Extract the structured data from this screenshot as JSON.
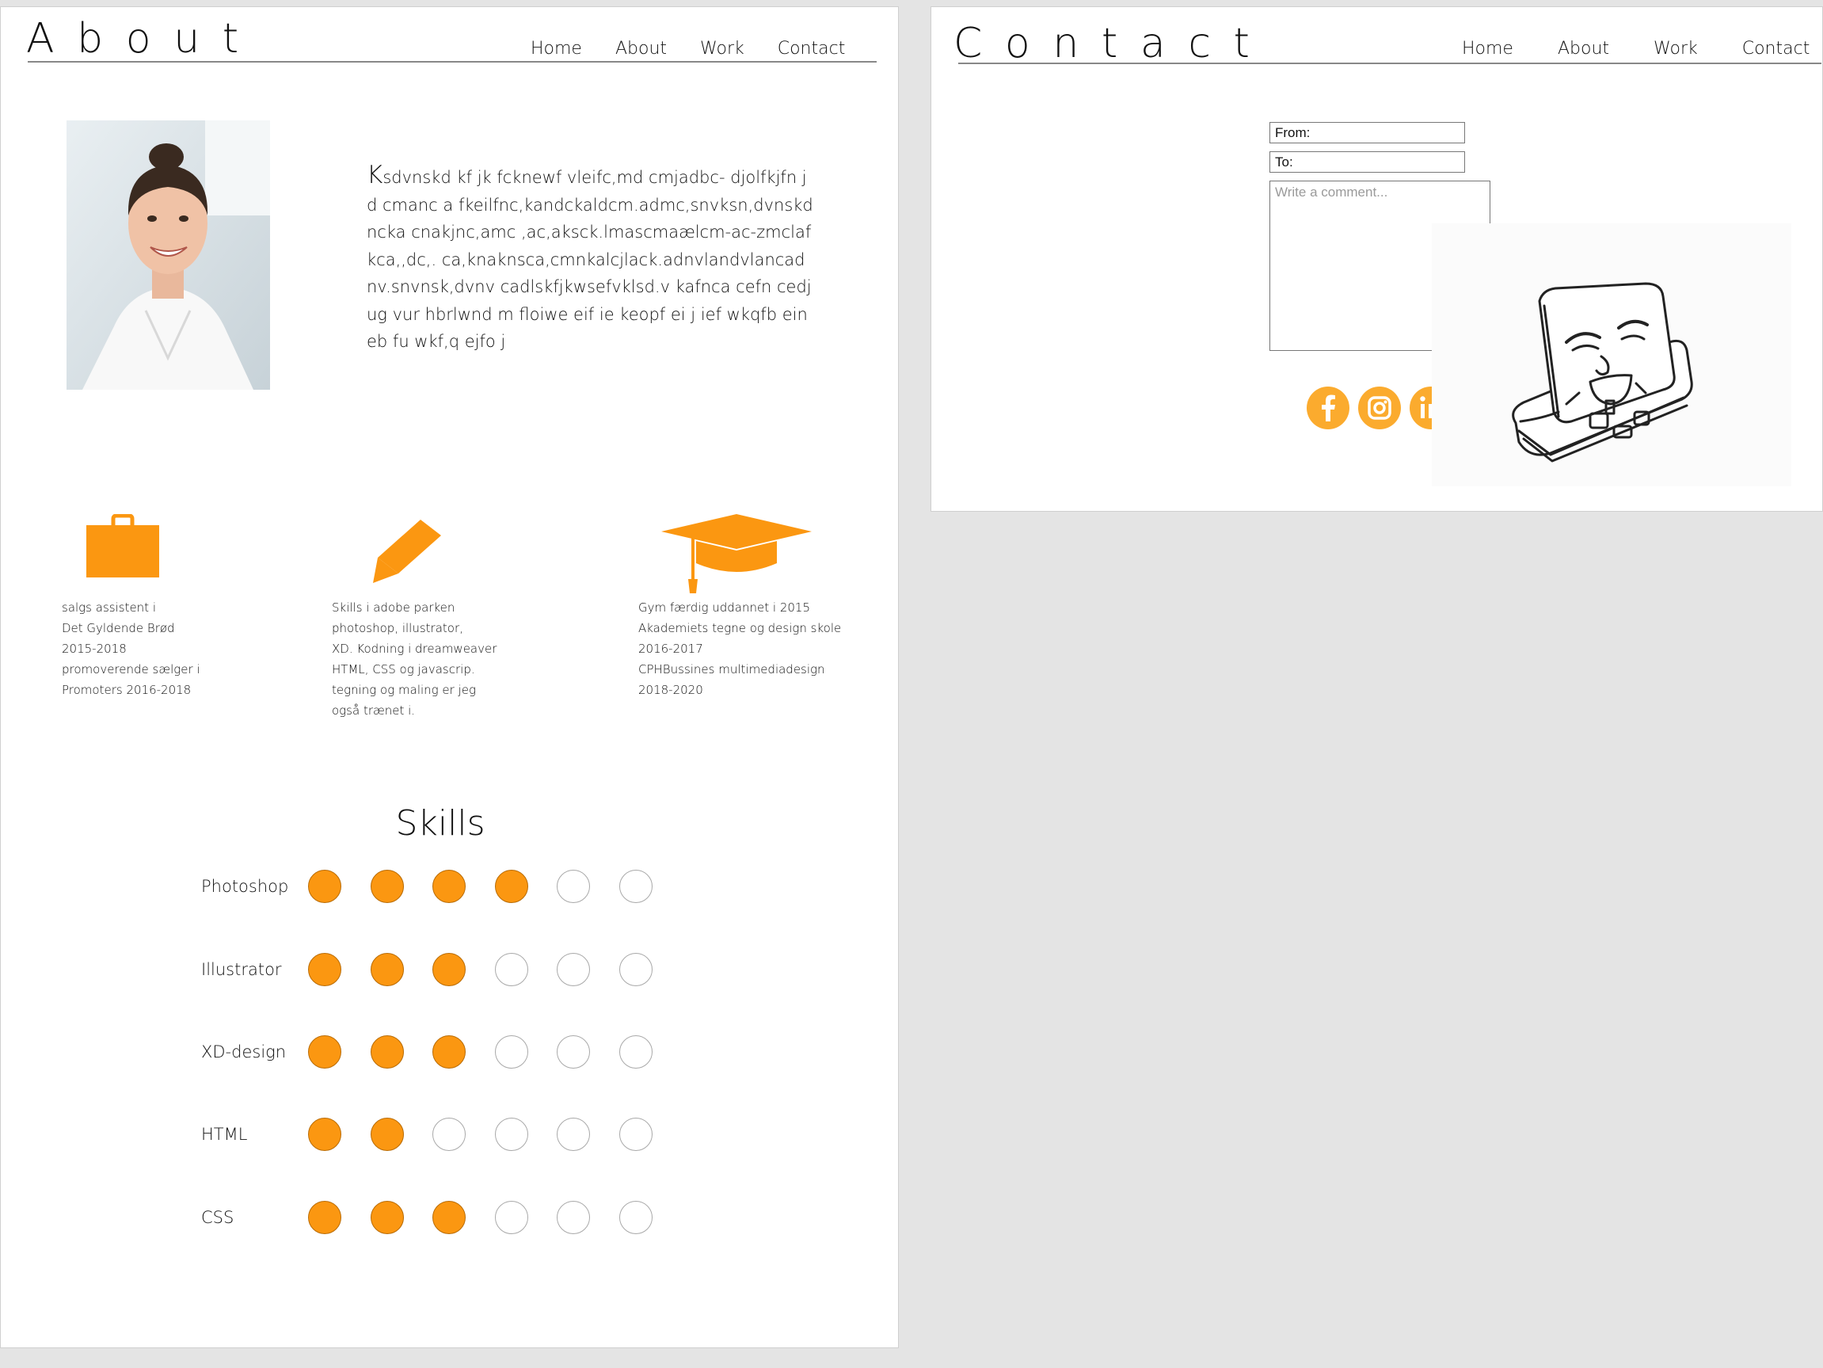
{
  "about": {
    "title": "About",
    "nav": [
      "Home",
      "About",
      "Work",
      "Contact"
    ],
    "bio": "Ksdvnskd kf jk fcknewf vleifc,md cmjadbc- djolfkjfn jd cmanc a fkeilfnc,kandckaldcm.admc,snvksn,dvnskdncka cnakjnc,amc ,ac,aksck.lmascmaælcm-ac-zmclafkca,,dc,. ca,knaknsca,cmnkalcjlack.adnvlandvlancadnv.snvnsk,dvnv cadlskfjkwsefvklsd.v kafnca cefn cedjug vur hbrlwnd m floiwe eif ie keopf ei j ief wkqfb eineb fu wkf,q ejfo j",
    "info": [
      {
        "icon": "briefcase-icon",
        "lines": [
          "salgs assistent i",
          "Det Gyldende Brød",
          "2015-2018",
          "promoverende sælger i",
          "Promoters 2016-2018"
        ]
      },
      {
        "icon": "pencil-icon",
        "lines": [
          "Skills i adobe parken",
          "photoshop, illustrator,",
          "XD. Kodning i dreamweaver",
          "HTML, CSS og javascrip.",
          "tegning og maling er jeg",
          "også trænet i."
        ]
      },
      {
        "icon": "graduation-cap-icon",
        "lines": [
          "Gym færdig uddannet i 2015",
          "Akademiets tegne og design skole",
          "2016-2017",
          "CPHBussines multimediadesign",
          "2018-2020"
        ]
      }
    ],
    "skills_title": "Skills",
    "skills": [
      {
        "name": "Photoshop",
        "level": 4,
        "max": 6
      },
      {
        "name": "Illustrator",
        "level": 3,
        "max": 6
      },
      {
        "name": "XD-design",
        "level": 3,
        "max": 6
      },
      {
        "name": "HTML",
        "level": 2,
        "max": 6
      },
      {
        "name": "CSS",
        "level": 3,
        "max": 6
      }
    ]
  },
  "contact": {
    "title": "Contact",
    "nav": [
      "Home",
      "About",
      "Work",
      "Contact"
    ],
    "from_value": "From:",
    "to_value": "To:",
    "comment_placeholder": "Write a comment...",
    "socials": [
      "facebook-icon",
      "instagram-icon",
      "linkedin-icon"
    ]
  },
  "colors": {
    "accent": "#fb9711",
    "social": "#fbab2e",
    "background": "#e4e4e4"
  }
}
